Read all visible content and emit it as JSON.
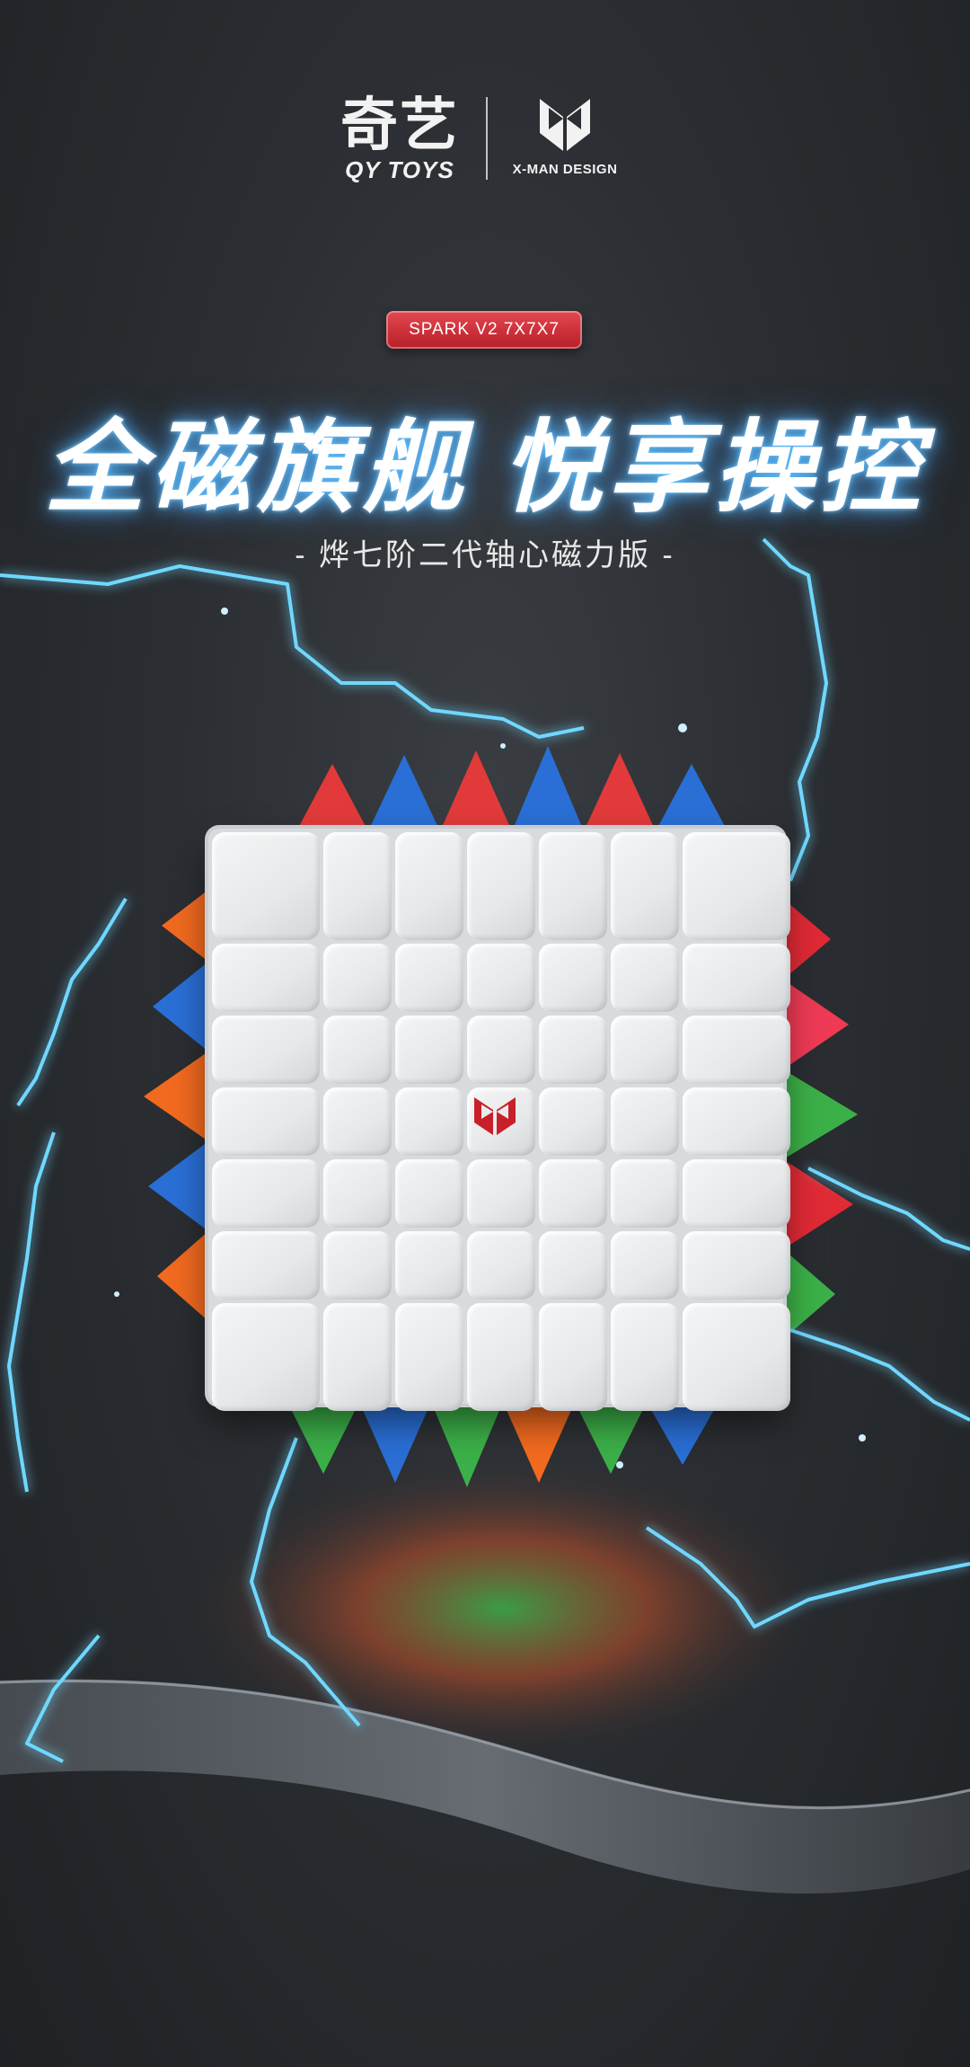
{
  "brand": {
    "qy_chinese": "奇艺",
    "qy_english": "QY TOYS",
    "xman": "X-MAN DESIGN",
    "logo_icon": "xman-bowtie-icon"
  },
  "badge": {
    "label": "SPARK V2 7X7X7"
  },
  "headline": "全磁旗舰 悦享操控",
  "subheadline": "- 烨七阶二代轴心磁力版 -",
  "cube": {
    "size": "7x7x7",
    "face_color": "#e8eaec",
    "logo_icon": "xman-logo-icon",
    "logo_color": "#c8202b"
  },
  "colors": {
    "accent_red": "#d12d36",
    "lightning": "#5ad0ff",
    "background": "#2b2e32"
  }
}
